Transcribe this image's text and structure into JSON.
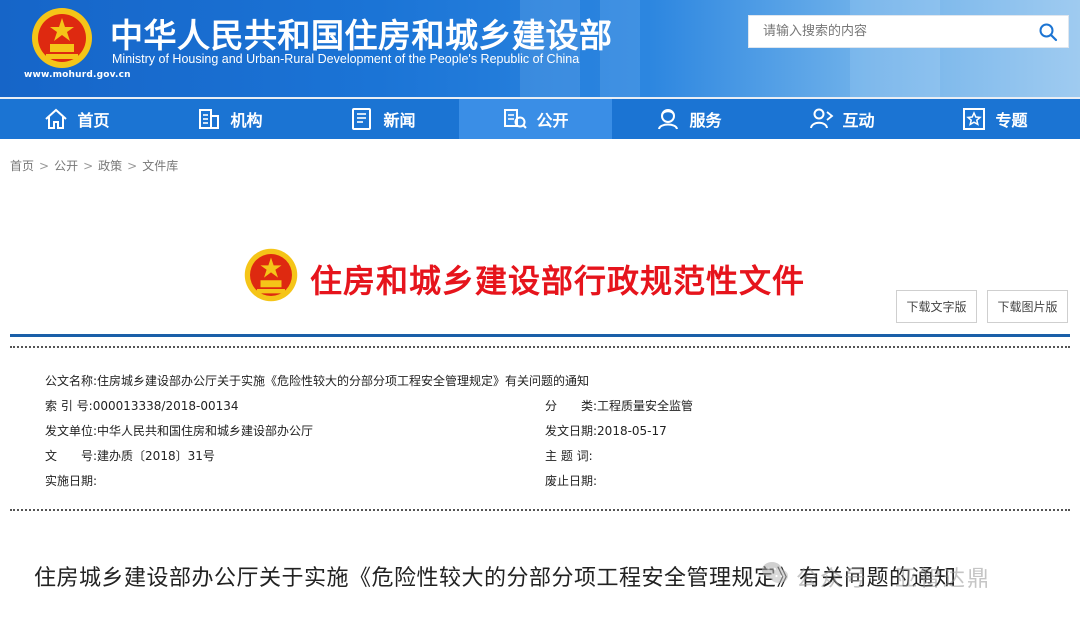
{
  "header": {
    "title": "中华人民共和国住房和城乡建设部",
    "subtitle": "Ministry of Housing and Urban-Rural Development of the People's Republic of China",
    "url": "www.mohurd.gov.cn",
    "search_placeholder": "请输入搜索的内容",
    "colors": {
      "header_blue": "#1b74d6",
      "nav_blue": "#1b74d3",
      "nav_active": "#3a8ee6"
    }
  },
  "nav": {
    "items": [
      {
        "label": "首页",
        "icon": "home-icon"
      },
      {
        "label": "机构",
        "icon": "building-icon"
      },
      {
        "label": "新闻",
        "icon": "news-icon"
      },
      {
        "label": "公开",
        "icon": "disclosure-icon",
        "active": true
      },
      {
        "label": "服务",
        "icon": "service-icon"
      },
      {
        "label": "互动",
        "icon": "interaction-icon"
      },
      {
        "label": "专题",
        "icon": "topic-icon"
      }
    ]
  },
  "breadcrumb": {
    "items": [
      "首页",
      "公开",
      "政策",
      "文件库"
    ],
    "separator": ">"
  },
  "doc_header": {
    "title": "住房和城乡建设部行政规范性文件",
    "download_text": "下载文字版",
    "download_image": "下载图片版",
    "title_color": "#e6141c"
  },
  "meta": {
    "doc_name_label": "公文名称:",
    "doc_name": "住房城乡建设部办公厅关于实施《危险性较大的分部分项工程安全管理规定》有关问题的通知",
    "index_label": "索 引 号:",
    "index": "000013338/2018-00134",
    "category_label": "分　　类:",
    "category": "工程质量安全监管",
    "issuer_label": "发文单位:",
    "issuer": "中华人民共和国住房和城乡建设部办公厅",
    "issue_date_label": "发文日期:",
    "issue_date": "2018-05-17",
    "doc_no_label": "文　　号:",
    "doc_no": "建办质〔2018〕31号",
    "keywords_label": "主 题 词:",
    "keywords": "",
    "effective_label": "实施日期:",
    "effective": "",
    "abolish_label": "废止日期:",
    "abolish": ""
  },
  "article": {
    "title": "住房城乡建设部办公厅关于实施《危险性较大的分部分项工程安全管理规定》有关问题的通知"
  },
  "watermark": {
    "text": "公众号 · 亚智达鼎",
    "icon": "wechat-icon"
  }
}
